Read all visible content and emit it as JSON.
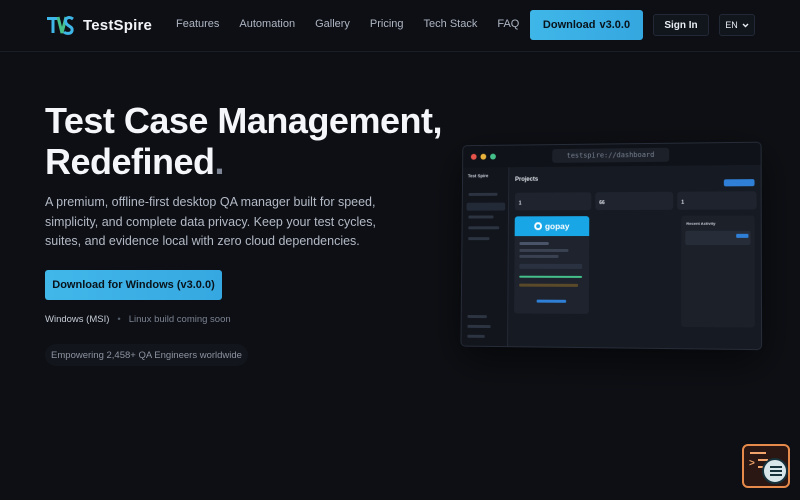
{
  "nav": {
    "brand": "TestSpire",
    "links": [
      "Features",
      "Automation",
      "Gallery",
      "Pricing",
      "Tech Stack",
      "FAQ"
    ],
    "download_label": "Download",
    "download_version": "v3.0.0",
    "signin_label": "Sign In",
    "lang_label": "EN"
  },
  "hero": {
    "title_line1": "Test Case Management,",
    "title_line2": "Redefined",
    "title_dot": ".",
    "description": "A premium, offline-first desktop QA manager built for speed, simplicity, and complete data privacy. Keep your test cycles, suites, and evidence local with zero cloud dependencies.",
    "download_button": "Download for Windows (v3.0.0)",
    "platform_primary": "Windows (MSI)",
    "platform_separator": "•",
    "platform_secondary": "Linux build coming soon",
    "badge": "Empowering 2,458+ QA Engineers worldwide"
  },
  "mockup": {
    "url": "testspire://dashboard",
    "sidebar_brand": "Test Spire",
    "page_title": "Projects",
    "card_brand": "gopay",
    "activity_title": "Recent Activity",
    "stat_values": [
      "1",
      "66",
      "1"
    ]
  },
  "colors": {
    "accent": "#3fb6e8",
    "background": "#0d0f14",
    "gopay": "#18a6e6"
  }
}
